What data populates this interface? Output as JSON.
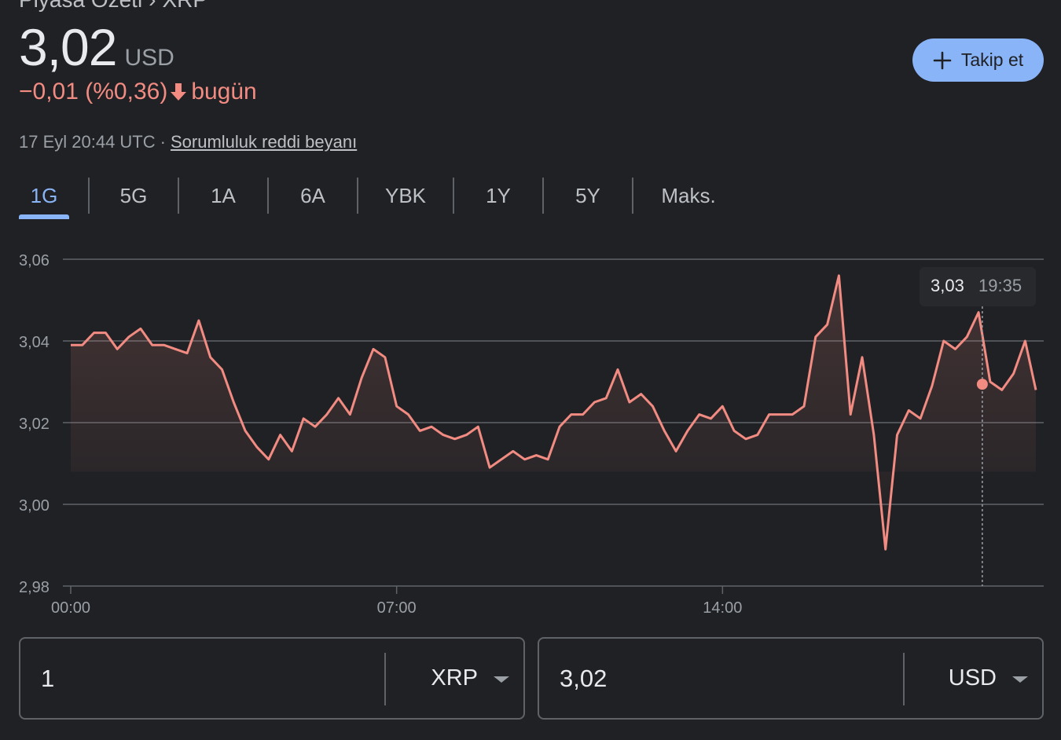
{
  "breadcrumb": {
    "parent": "Piyasa Özeti",
    "separator": "›",
    "current": "XRP"
  },
  "price": {
    "value": "3,02",
    "currency": "USD"
  },
  "change": {
    "amount": "−0,01",
    "percent": "(%0,36)",
    "suffix": "bugün",
    "color": "#f28b82",
    "arrow_icon": "arrow-down-icon"
  },
  "follow_button": {
    "label": "Takip et",
    "icon": "plus-icon"
  },
  "meta": {
    "timestamp": "17 Eyl 20:44 UTC",
    "separator": "·",
    "disclaimer": "Sorumluluk reddi beyanı"
  },
  "tabs": [
    {
      "label": "1G",
      "active": true
    },
    {
      "label": "5G"
    },
    {
      "label": "1A"
    },
    {
      "label": "6A"
    },
    {
      "label": "YBK"
    },
    {
      "label": "1Y"
    },
    {
      "label": "5Y"
    },
    {
      "label": "Maks."
    }
  ],
  "chart_data": {
    "type": "line",
    "y_ticks": [
      "3,06",
      "3,04",
      "3,02",
      "3,00",
      "2,98"
    ],
    "y_tick_values": [
      3.06,
      3.04,
      3.02,
      3.0,
      2.98
    ],
    "ylim": [
      2.98,
      3.06
    ],
    "x_ticks": [
      "00:00",
      "07:00",
      "14:00"
    ],
    "x_tick_values": [
      0,
      7,
      14
    ],
    "xlim": [
      0,
      20.73
    ],
    "grid": true,
    "line_color": "#f28b82",
    "tooltip": {
      "value": "3,03",
      "time": "19:35",
      "x": 19.58,
      "y": 3.0294
    },
    "series": [
      {
        "x": [
          0,
          0.25,
          0.5,
          0.75,
          1.0,
          1.25,
          1.5,
          1.75,
          2.0,
          2.25,
          2.5,
          2.75,
          3.0,
          3.25,
          3.5,
          3.75,
          4.0,
          4.25,
          4.5,
          4.75,
          5.0,
          5.25,
          5.5,
          5.75,
          6.0,
          6.25,
          6.5,
          6.75,
          7.0,
          7.25,
          7.5,
          7.75,
          8.0,
          8.25,
          8.5,
          8.75,
          9.0,
          9.25,
          9.5,
          9.75,
          10.0,
          10.25,
          10.5,
          10.75,
          11.0,
          11.25,
          11.5,
          11.75,
          12.0,
          12.25,
          12.5,
          12.75,
          13.0,
          13.25,
          13.5,
          13.75,
          14.0,
          14.25,
          14.5,
          14.75,
          15.0,
          15.25,
          15.5,
          15.75,
          16.0,
          16.25,
          16.5,
          16.75,
          17.0,
          17.25,
          17.5,
          17.75,
          18.0,
          18.25,
          18.5,
          18.75,
          19.0,
          19.25,
          19.5,
          19.75,
          20.0,
          20.25,
          20.5,
          20.73
        ],
        "y": [
          3.039,
          3.039,
          3.042,
          3.042,
          3.038,
          3.041,
          3.043,
          3.039,
          3.039,
          3.038,
          3.037,
          3.045,
          3.036,
          3.033,
          3.025,
          3.018,
          3.014,
          3.011,
          3.017,
          3.013,
          3.021,
          3.019,
          3.022,
          3.026,
          3.022,
          3.031,
          3.038,
          3.036,
          3.024,
          3.022,
          3.018,
          3.019,
          3.017,
          3.016,
          3.017,
          3.019,
          3.009,
          3.011,
          3.013,
          3.011,
          3.012,
          3.011,
          3.019,
          3.022,
          3.022,
          3.025,
          3.026,
          3.033,
          3.025,
          3.027,
          3.024,
          3.018,
          3.013,
          3.018,
          3.022,
          3.021,
          3.024,
          3.018,
          3.016,
          3.017,
          3.022,
          3.022,
          3.022,
          3.024,
          3.041,
          3.044,
          3.056,
          3.022,
          3.036,
          3.017,
          2.989,
          3.017,
          3.023,
          3.021,
          3.029,
          3.04,
          3.038,
          3.041,
          3.047,
          3.03,
          3.028,
          3.032,
          3.04,
          3.028
        ]
      }
    ]
  },
  "converter": {
    "left": {
      "value": "1",
      "unit": "XRP"
    },
    "right": {
      "value": "3,02",
      "unit": "USD"
    }
  }
}
